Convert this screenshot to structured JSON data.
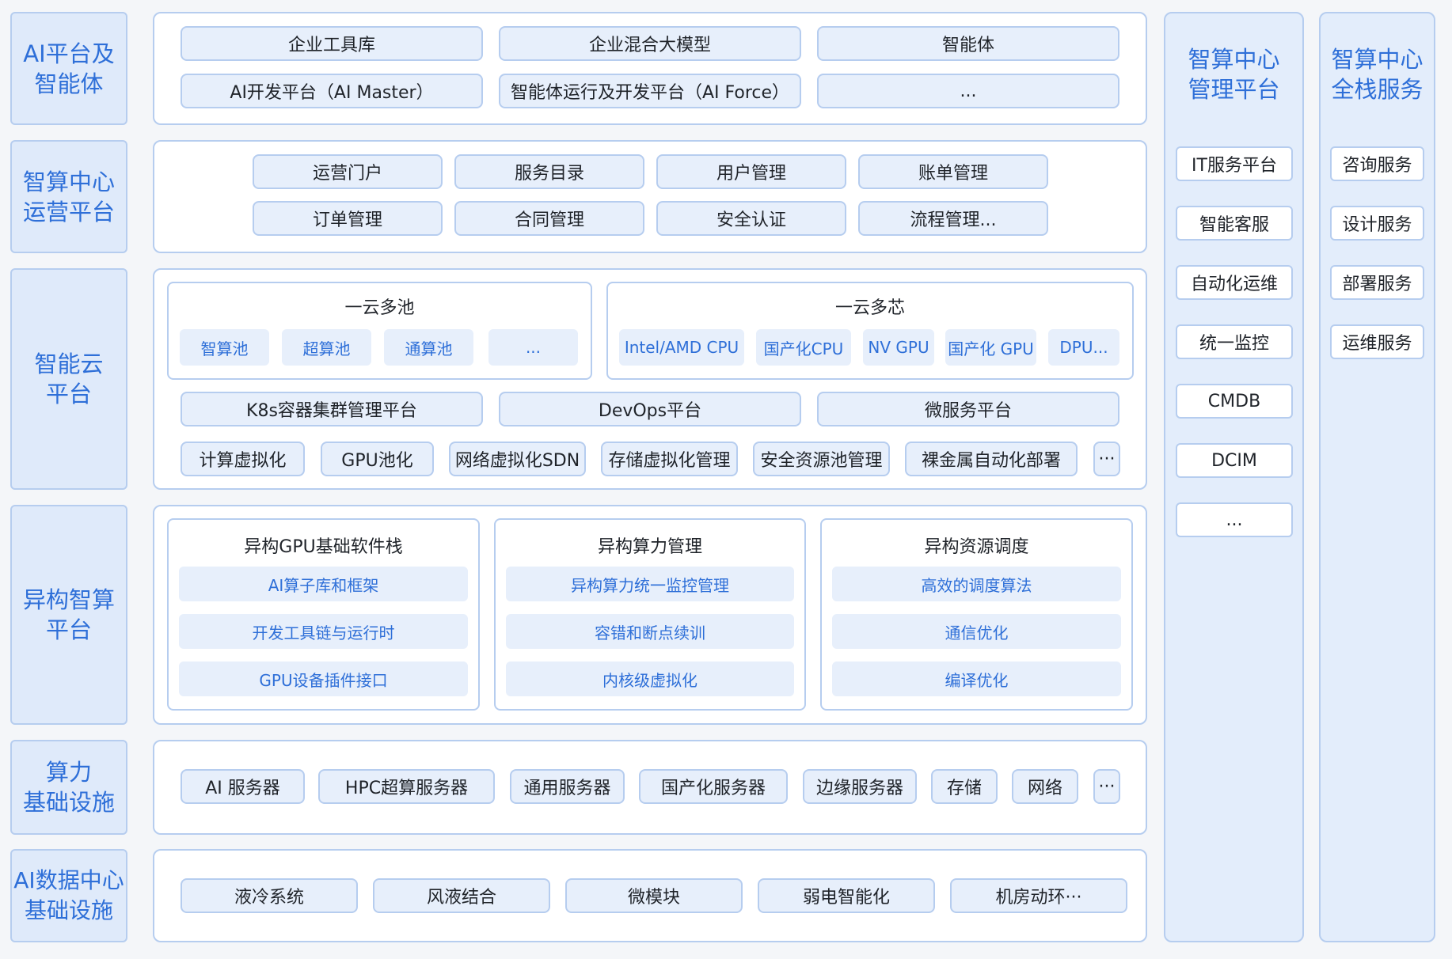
{
  "layers": [
    {
      "label": "AI平台及\n智能体"
    },
    {
      "label": "智算中心\n运营平台"
    },
    {
      "label": "智能云\n平台"
    },
    {
      "label": "异构智算\n平台"
    },
    {
      "label": "算力\n基础设施"
    },
    {
      "label": "AI数据中心\n基础设施"
    }
  ],
  "ai_platform": [
    "企业工具库",
    "企业混合大模型",
    "智能体",
    "AI开发平台（AI Master）",
    "智能体运行及开发平台（AI Force）",
    "..."
  ],
  "ops_platform": [
    "运营门户",
    "服务目录",
    "用户管理",
    "账单管理",
    "订单管理",
    "合同管理",
    "安全认证",
    "流程管理..."
  ],
  "cloud": {
    "pool_title": "一云多池",
    "pools": [
      "智算池",
      "超算池",
      "通算池",
      "..."
    ],
    "chip_title": "一云多芯",
    "chips": [
      "Intel/AMD CPU",
      "国产化CPU",
      "NV GPU",
      "国产化 GPU",
      "DPU..."
    ],
    "platforms": [
      "K8s容器集群管理平台",
      "DevOps平台",
      "微服务平台"
    ],
    "virtualization": [
      "计算虚拟化",
      "GPU池化",
      "网络虚拟化SDN",
      "存储虚拟化管理",
      "安全资源池管理",
      "裸金属自动化部署",
      "···"
    ]
  },
  "hetero": [
    {
      "title": "异构GPU基础软件栈",
      "items": [
        "AI算子库和框架",
        "开发工具链与运行时",
        "GPU设备插件接口"
      ]
    },
    {
      "title": "异构算力管理",
      "items": [
        "异构算力统一监控管理",
        "容错和断点续训",
        "内核级虚拟化"
      ]
    },
    {
      "title": "异构资源调度",
      "items": [
        "高效的调度算法",
        "通信优化",
        "编译优化"
      ]
    }
  ],
  "compute_infra": [
    "AI 服务器",
    "HPC超算服务器",
    "通用服务器",
    "国产化服务器",
    "边缘服务器",
    "存储",
    "网络",
    "···"
  ],
  "dc_infra": [
    "液冷系统",
    "风液结合",
    "微模块",
    "弱电智能化",
    "机房动环···"
  ],
  "mgmt": {
    "title": "智算中心\n管理平台",
    "items": [
      "IT服务平台",
      "智能客服",
      "自动化运维",
      "统一监控",
      "CMDB",
      "DCIM",
      "..."
    ]
  },
  "service": {
    "title": "智算中心\n全栈服务",
    "items": [
      "咨询服务",
      "设计服务",
      "部署服务",
      "运维服务"
    ]
  }
}
